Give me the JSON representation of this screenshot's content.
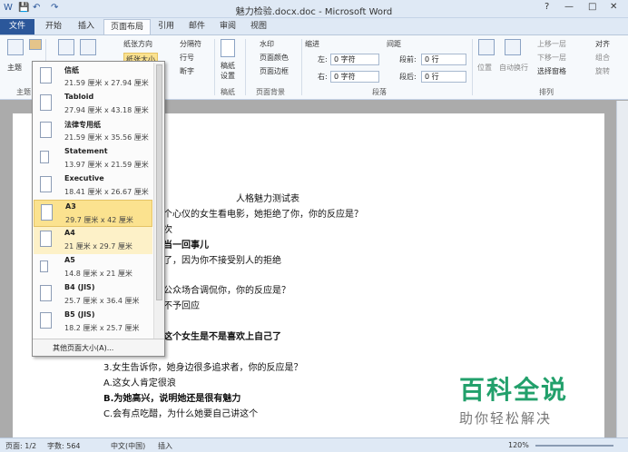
{
  "window": {
    "title": "魅力检验.docx.doc - Microsoft Word",
    "quick_access": [
      "W",
      "💾",
      "↶",
      "↷"
    ],
    "controls": [
      "?",
      "—",
      "□",
      "✕"
    ]
  },
  "tabs": [
    {
      "label": "文件"
    },
    {
      "label": "开始"
    },
    {
      "label": "插入"
    },
    {
      "label": "页面布局"
    },
    {
      "label": "引用"
    },
    {
      "label": "邮件"
    },
    {
      "label": "审阅"
    },
    {
      "label": "视图"
    }
  ],
  "ribbon": {
    "theme_label": "主题",
    "theme_group": "主题",
    "orientation": "纸张方向",
    "paper_size": "纸张大小",
    "breaks": "分隔符",
    "line_numbers": "行号",
    "hyphenation": "断字",
    "draft": "稿纸\n设置",
    "draft_group": "稿纸",
    "watermark": "水印",
    "page_color": "页面颜色",
    "page_border": "页面边框",
    "bg_group": "页面背景",
    "indent_title": "缩进",
    "spacing_title": "间距",
    "indent_left_label": "左:",
    "indent_left_value": "0 字符",
    "indent_right_label": "右:",
    "indent_right_value": "0 字符",
    "spacing_before_label": "段前:",
    "spacing_before_value": "0 行",
    "spacing_after_label": "段后:",
    "spacing_after_value": "0 行",
    "paragraph_group": "段落",
    "position": "位置",
    "wrap": "自动换行",
    "bring_forward": "上移一层",
    "send_backward": "下移一层",
    "selection_pane": "选择窗格",
    "align": "对齐",
    "group": "组合",
    "rotate": "旋转",
    "arrange_group": "排列"
  },
  "paper_menu": {
    "items": [
      {
        "name": "信纸",
        "size": "21.59 厘米 x 27.94 厘米"
      },
      {
        "name": "Tabloid",
        "size": "27.94 厘米 x 43.18 厘米"
      },
      {
        "name": "法律专用纸",
        "size": "21.59 厘米 x 35.56 厘米"
      },
      {
        "name": "Statement",
        "size": "13.97 厘米 x 21.59 厘米"
      },
      {
        "name": "Executive",
        "size": "18.41 厘米 x 26.67 厘米"
      },
      {
        "name": "A3",
        "size": "29.7 厘米 x 42 厘米"
      },
      {
        "name": "A4",
        "size": "21 厘米 x 29.7 厘米"
      },
      {
        "name": "A5",
        "size": "14.8 厘米 x 21 厘米"
      },
      {
        "name": "B4 (JIS)",
        "size": "25.7 厘米 x 36.4 厘米"
      },
      {
        "name": "B5 (JIS)",
        "size": "18.2 厘米 x 25.7 厘米"
      }
    ],
    "more": "其他页面大小(A)..."
  },
  "document": {
    "title": "人格魅力测试表",
    "lines": [
      "个心仪的女生看电影，她拒绝了你，你的反应是？",
      "次",
      "当一回事儿",
      "了，因为你不接受别人的拒绝",
      "公众场合调侃你，你的反应是？",
      "不予回应",
      "这个女生是不是喜欢上自己了",
      "3.女生告诉你，她身边很多追求者，你的反应是？",
      "A.这女人肯定很浪",
      "B.为她高兴，说明她还是很有魅力",
      "C.会有点吃醋，为什么她要自己讲这个"
    ]
  },
  "status": {
    "page": "页面: 1/2",
    "words": "字数: 564",
    "language": "中文(中国)",
    "mode": "插入",
    "zoom": "120%"
  },
  "watermark": {
    "main": "百科全说",
    "sub": "助你轻松解决"
  },
  "colors": {
    "accent": "#2b579a",
    "selected": "#fbe28f",
    "watermark": "#22a06b"
  }
}
